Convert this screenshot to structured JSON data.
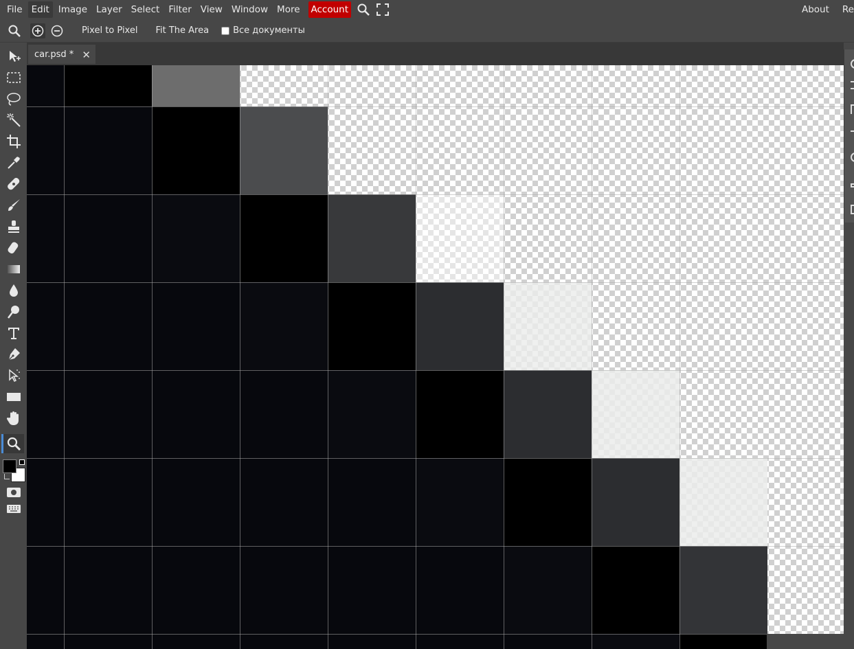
{
  "menubar": {
    "items": [
      "File",
      "Edit",
      "Image",
      "Layer",
      "Select",
      "Filter",
      "View",
      "Window",
      "More"
    ],
    "active_item": "Edit",
    "account_label": "Account",
    "right_items": [
      "About",
      "Re"
    ]
  },
  "options_bar": {
    "pixel_to_pixel": "Pixel to Pixel",
    "fit_the_area": "Fit The Area",
    "all_documents_label": "Все документы",
    "all_documents_checked": false
  },
  "document": {
    "tab_title": "car.psd *"
  },
  "colors": {
    "foreground": "#000000",
    "background": "#ffffff",
    "account_bg": "#c10000",
    "active_tool_accent": "#4a8cd6"
  },
  "tools": [
    "move-tool-icon",
    "marquee-tool-icon",
    "lasso-tool-icon",
    "magic-wand-tool-icon",
    "crop-tool-icon",
    "eyedropper-tool-icon",
    "healing-tool-icon",
    "brush-tool-icon",
    "clone-stamp-tool-icon",
    "eraser-tool-icon",
    "gradient-tool-icon",
    "blur-tool-icon",
    "dodge-tool-icon",
    "text-tool-icon",
    "pen-tool-icon",
    "path-select-tool-icon",
    "rectangle-tool-icon",
    "hand-tool-icon",
    "zoom-tool-icon"
  ],
  "active_tool": "zoom-tool-icon"
}
